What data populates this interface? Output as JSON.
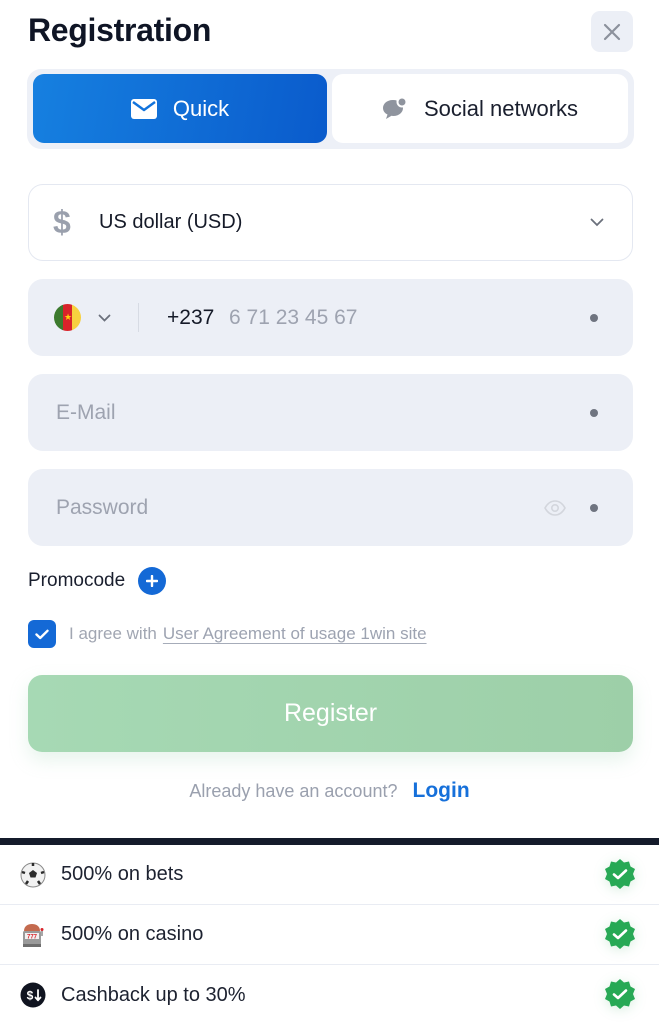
{
  "header": {
    "title": "Registration",
    "close_icon": "close-icon"
  },
  "tabs": [
    {
      "label": "Quick",
      "icon": "envelope-icon",
      "active": true
    },
    {
      "label": "Social networks",
      "icon": "chat-bubble-icon",
      "active": false
    }
  ],
  "form": {
    "currency": {
      "icon": "dollar-icon",
      "symbol": "$",
      "value": "US dollar (USD)"
    },
    "phone": {
      "country": "Cameroon",
      "code": "+237",
      "placeholder": "6 71 23 45 67"
    },
    "email": {
      "placeholder": "E-Mail",
      "value": ""
    },
    "password": {
      "placeholder": "Password",
      "value": ""
    },
    "promocode_label": "Promocode",
    "agreement": {
      "checked": true,
      "prefix": "I agree with",
      "link": "User Agreement of usage 1win site"
    },
    "register_label": "Register",
    "login_prompt": "Already have an account?",
    "login_link": "Login"
  },
  "bonuses": [
    {
      "icon": "soccer-ball-icon",
      "text": "500% on bets",
      "checked": true
    },
    {
      "icon": "slot-machine-icon",
      "text": "500% on casino",
      "checked": true
    },
    {
      "icon": "cashback-icon",
      "text": "Cashback up to 30%",
      "checked": true
    }
  ],
  "colors": {
    "primary": "#1469d6",
    "register_disabled": "#a2d5b0",
    "check_green": "#27a955",
    "field_bg": "#eceff6"
  }
}
